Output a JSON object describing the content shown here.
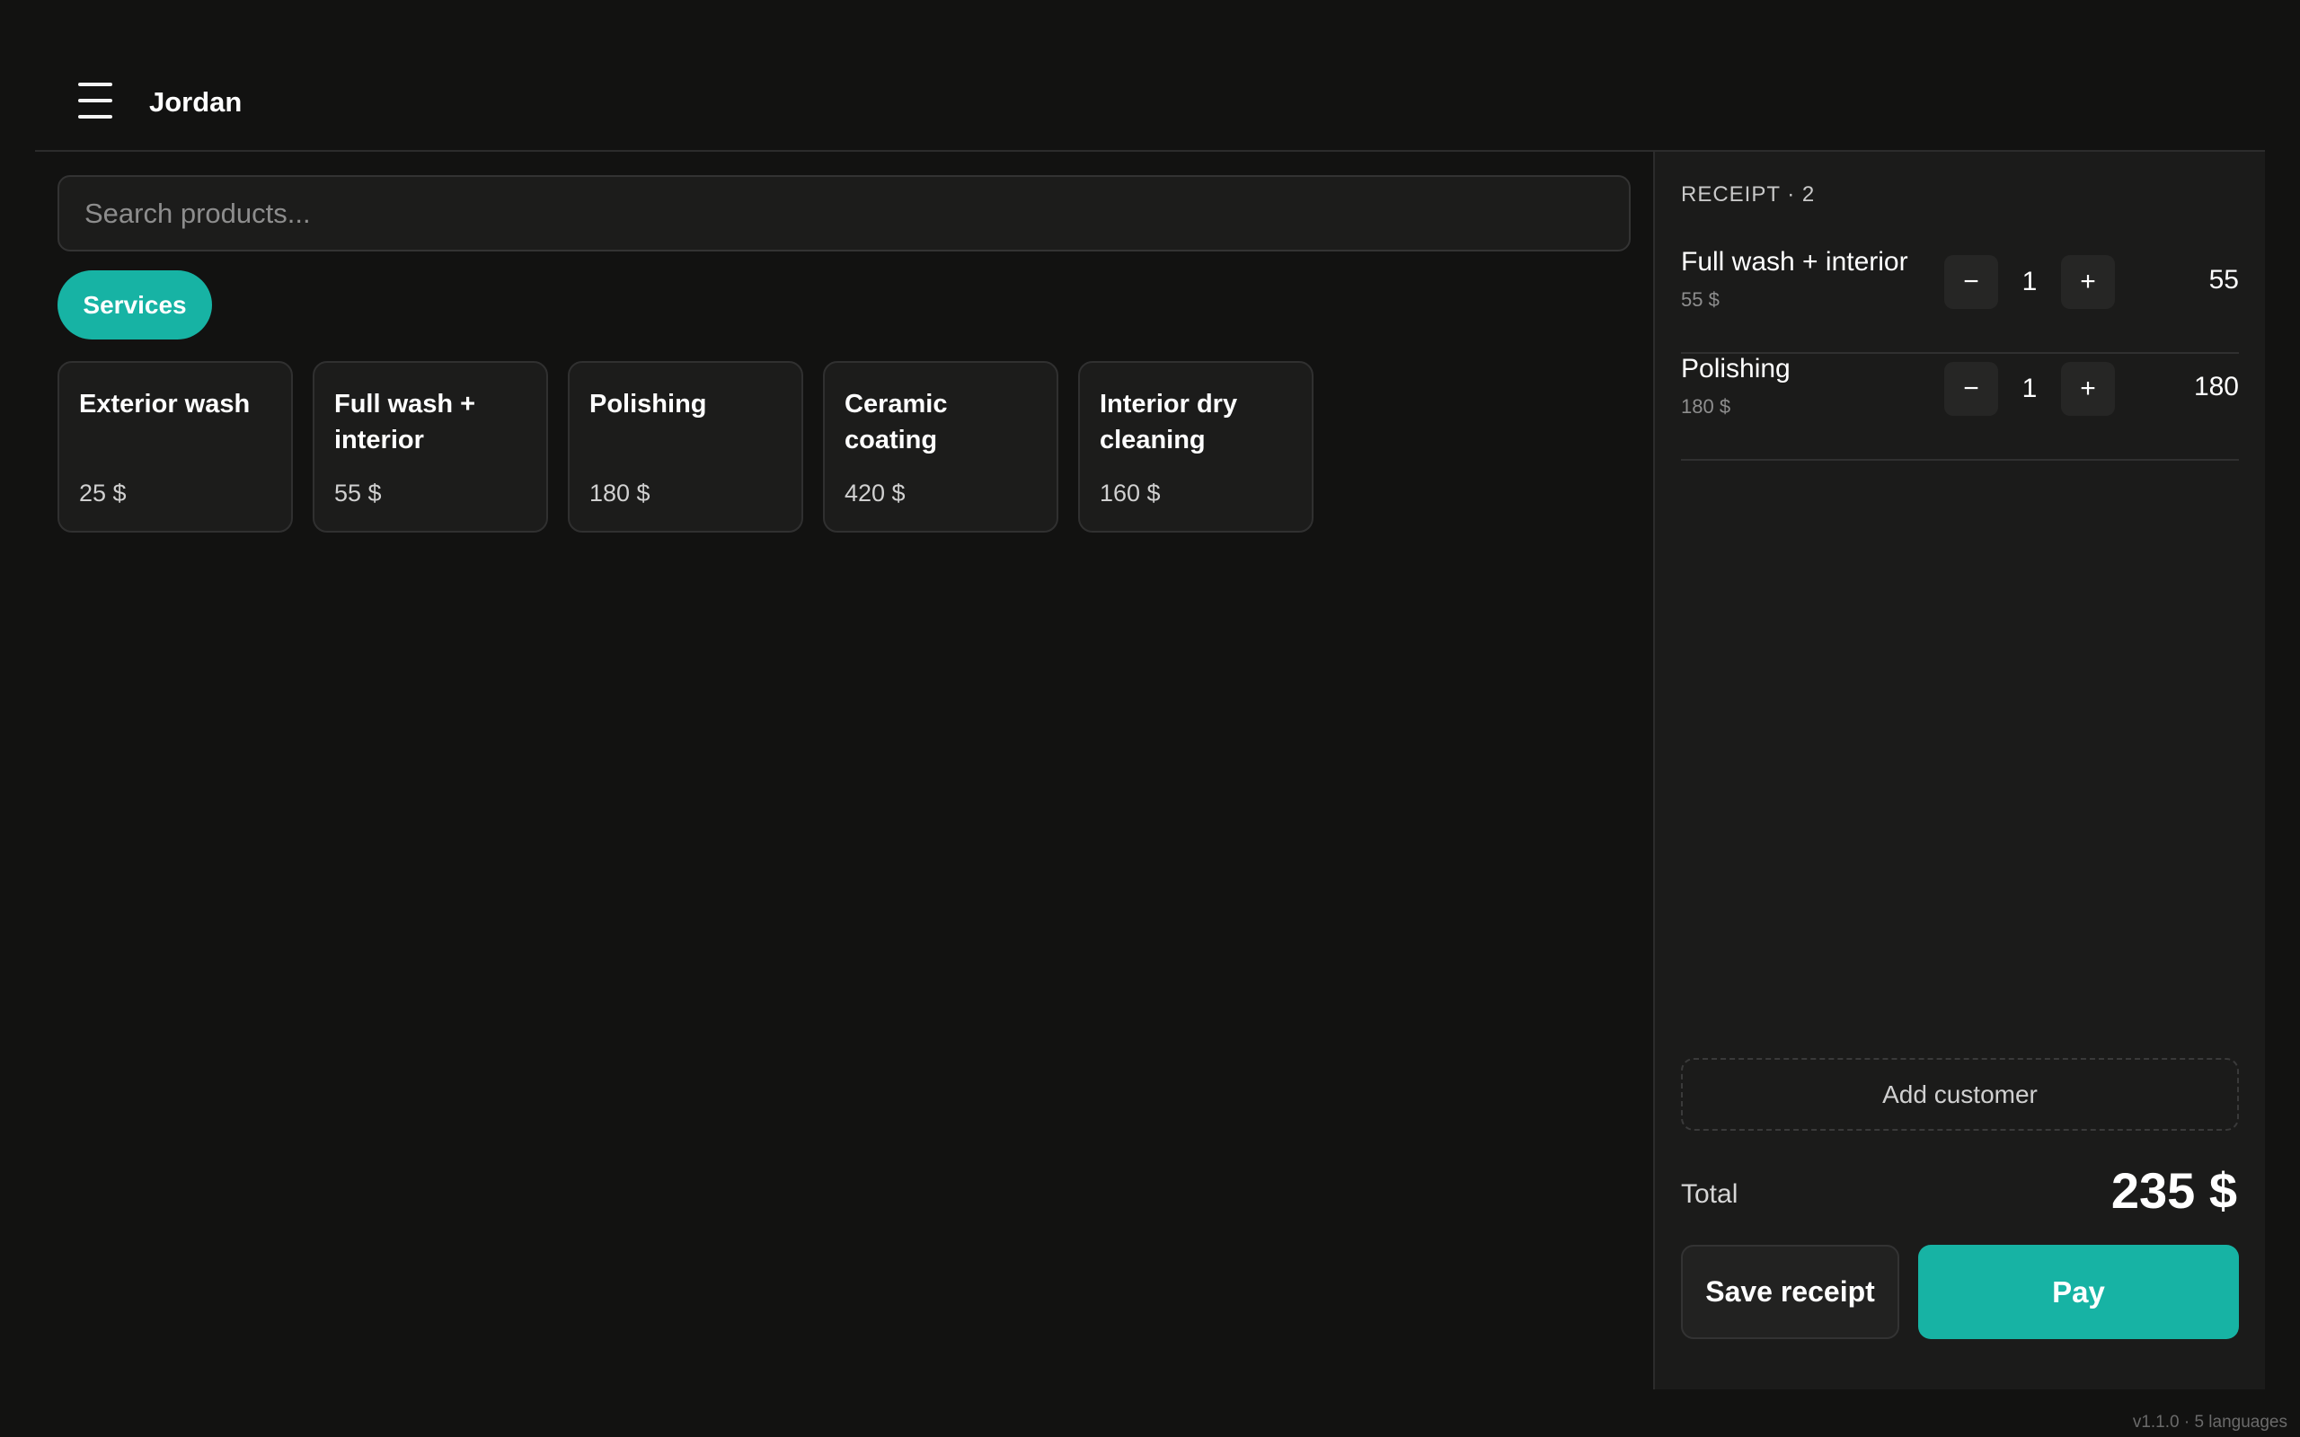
{
  "header": {
    "menu_icon": "hamburger-menu-icon",
    "user_name": "Jordan"
  },
  "search": {
    "placeholder": "Search products...",
    "value": ""
  },
  "categories": [
    {
      "label": "Services",
      "active": true
    }
  ],
  "products": [
    {
      "name": "Exterior wash",
      "price": "25 $"
    },
    {
      "name": "Full wash + interior",
      "price": "55 $"
    },
    {
      "name": "Polishing",
      "price": "180 $"
    },
    {
      "name": "Ceramic coating",
      "price": "420 $"
    },
    {
      "name": "Interior dry cleaning",
      "price": "160 $"
    }
  ],
  "receipt": {
    "title": "RECEIPT · 2",
    "lines": [
      {
        "name": "Full wash + interior",
        "unit_price": "55 $",
        "minus": "−",
        "qty": "1",
        "plus": "+",
        "total": "55"
      },
      {
        "name": "Polishing",
        "unit_price": "180 $",
        "minus": "−",
        "qty": "1",
        "plus": "+",
        "total": "180"
      }
    ],
    "add_customer_label": "Add customer",
    "total_label": "Total",
    "total_value": "235 $",
    "save_label": "Save receipt",
    "pay_label": "Pay"
  },
  "footer": {
    "version": "v1.1.0 · 5 languages"
  },
  "colors": {
    "background": "#121211",
    "panel": "#1b1b1a",
    "accent": "#17b3a4"
  }
}
